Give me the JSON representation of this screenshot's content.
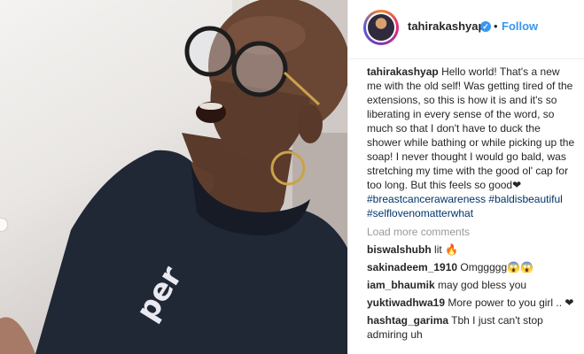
{
  "post": {
    "author": {
      "username": "tahirakashyap",
      "verified_glyph": "✓",
      "separator": "•",
      "follow_label": "Follow"
    },
    "caption": {
      "username": "tahirakashyap",
      "text": "Hello world! That's a new me with the old self! Was getting tired of the extensions, so this is how it is and it's so liberating in every sense of the word, so much so that I don't have to duck the shower while bathing or while picking up the soap! I never thought I would go bald, was stretching my time with the good ol' cap for too long. But this feels so good❤",
      "hashtags": [
        "#breastcancerawareness",
        "#baldisbeautiful",
        "#selflovenomatterwhat"
      ]
    },
    "load_more_label": "Load more comments",
    "comments": [
      {
        "username": "biswalshubh",
        "text": "lit 🔥"
      },
      {
        "username": "sakinadeem_1910",
        "text": "Omggggg😱😱"
      },
      {
        "username": "iam_bhaumik",
        "text": "may god bless you"
      },
      {
        "username": "yuktiwadhwa19",
        "text": "More power to you girl .. ❤"
      },
      {
        "username": "hashtag_garima",
        "text": "Tbh I just can't stop admiring uh"
      }
    ]
  },
  "icons": {
    "verified": "verified-badge-icon",
    "carousel": "carousel-nav-icon"
  },
  "colors": {
    "link_blue": "#3897f0",
    "hashtag_blue": "#003569",
    "muted_gray": "#999999",
    "text": "#262626"
  }
}
